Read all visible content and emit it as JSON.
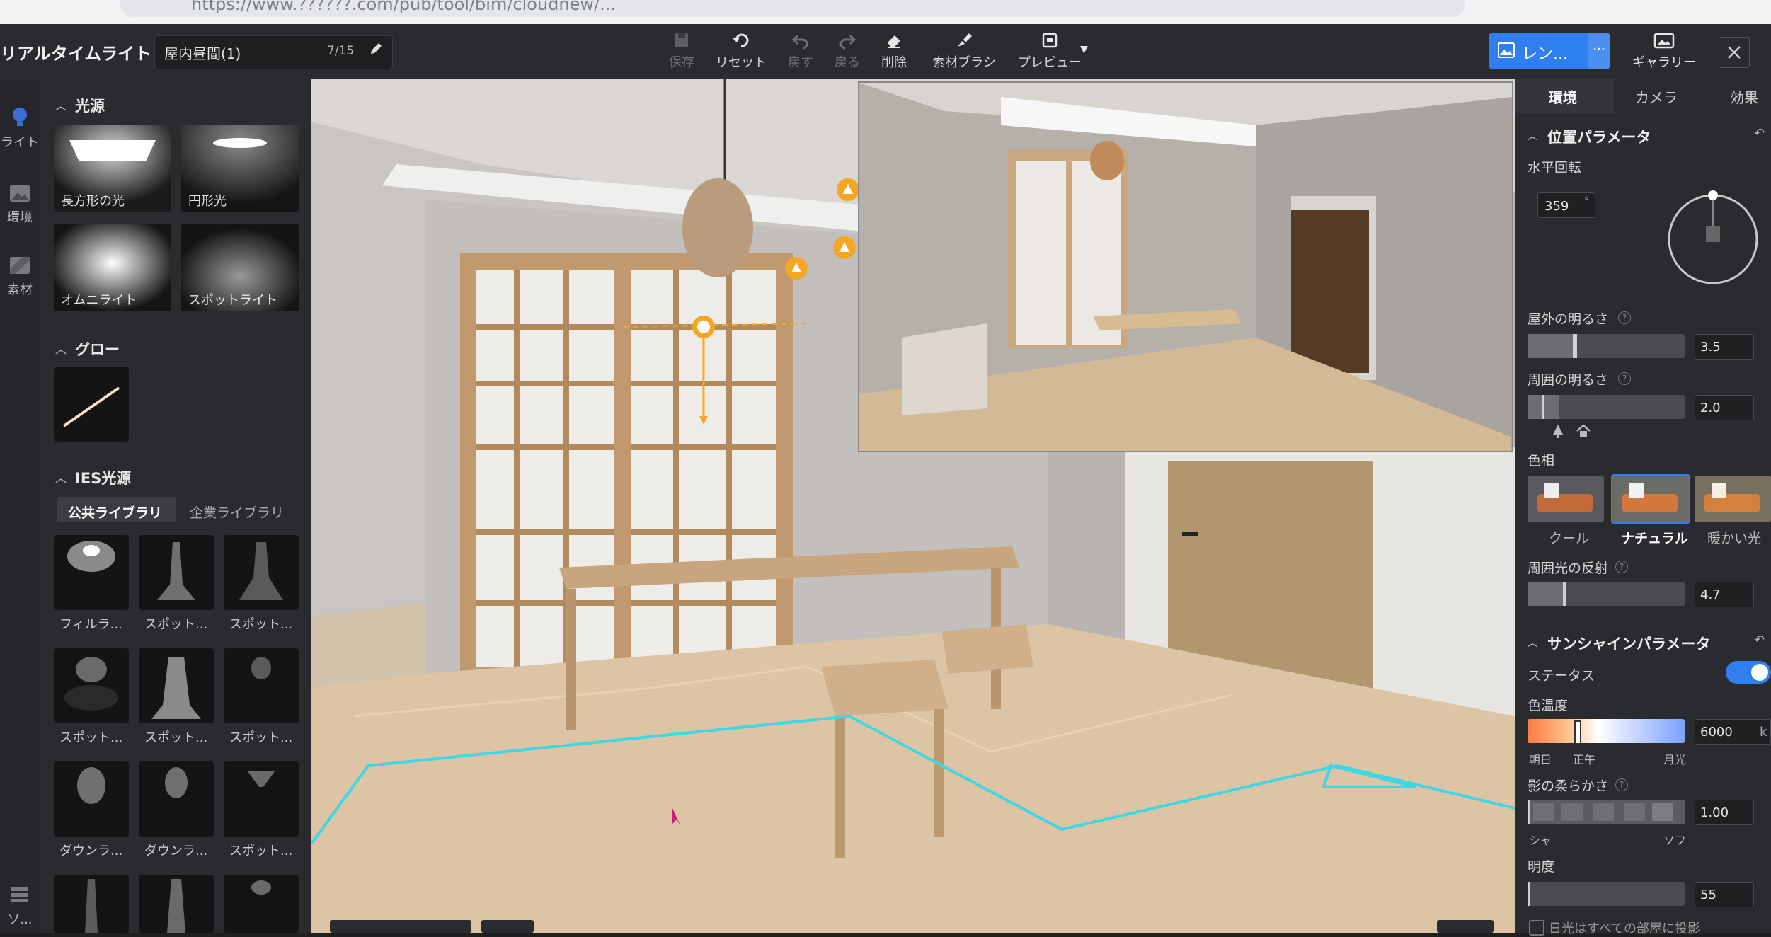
{
  "browser": {
    "url": "https://www.??????.com/pub/tool/bim/cloudnew/..."
  },
  "app": {
    "title": "リアルタイムライト",
    "scene_name": "屋内昼間(1)",
    "scene_count": "7/15"
  },
  "toolbar": {
    "save": "保存",
    "reset": "リセット",
    "undo": "戻す",
    "redo": "戻る",
    "delete": "削除",
    "material_brush": "素材ブラシ",
    "preview": "プレビュー",
    "render": "レン...",
    "render_more": "···",
    "gallery": "ギャラリー"
  },
  "rail": {
    "light": "ライト",
    "environment": "環境",
    "material": "素材",
    "bottom": "ソ..."
  },
  "left_panel": {
    "light_source": {
      "title": "光源",
      "items": [
        {
          "label": "長方形の光"
        },
        {
          "label": "円形光"
        },
        {
          "label": "オムニライト"
        },
        {
          "label": "スポットライト"
        }
      ]
    },
    "glow": {
      "title": "グロー"
    },
    "ies": {
      "title": "IES光源",
      "tab_public": "公共ライブラリ",
      "tab_enterprise": "企業ライブラリ",
      "items": [
        {
          "label": "フィルラ..."
        },
        {
          "label": "スポット..."
        },
        {
          "label": "スポット..."
        },
        {
          "label": "スポット..."
        },
        {
          "label": "スポット..."
        },
        {
          "label": "スポット..."
        },
        {
          "label": "ダウンラ..."
        },
        {
          "label": "ダウンラ..."
        },
        {
          "label": "スポット..."
        }
      ]
    }
  },
  "right_panel": {
    "tabs": {
      "environment": "環境",
      "camera": "カメラ",
      "effects": "効果"
    },
    "position": {
      "title": "位置パラメータ",
      "rotation_label": "水平回転",
      "rotation_value": "359",
      "rotation_unit": "°",
      "outdoor_label": "屋外の明るさ",
      "outdoor_value": "3.5",
      "ambient_label": "周囲の明るさ",
      "ambient_value": "2.0",
      "hue_label": "色相",
      "hue_options": [
        {
          "label": "クール"
        },
        {
          "label": "ナチュラル"
        },
        {
          "label": "暖かい光"
        }
      ],
      "reflection_label": "周囲光の反射",
      "reflection_value": "4.7"
    },
    "sunshine": {
      "title": "サンシャインパラメータ",
      "status_label": "ステータス",
      "temp_label": "色温度",
      "temp_value": "6000",
      "temp_unit": "k",
      "temp_marks": [
        "朝日",
        "正午",
        "月光"
      ],
      "softness_label": "影の柔らかさ",
      "softness_value": "1.00",
      "softness_marks": [
        "シャ",
        "ソフ"
      ],
      "brightness_label": "明度",
      "brightness_value": "55",
      "sunlight_all_rooms": "日光はすべての部屋に投影"
    }
  },
  "colors": {
    "accent": "#2f7ff0",
    "selection": "#3fd6e6",
    "light_handle": "#f5a623"
  }
}
